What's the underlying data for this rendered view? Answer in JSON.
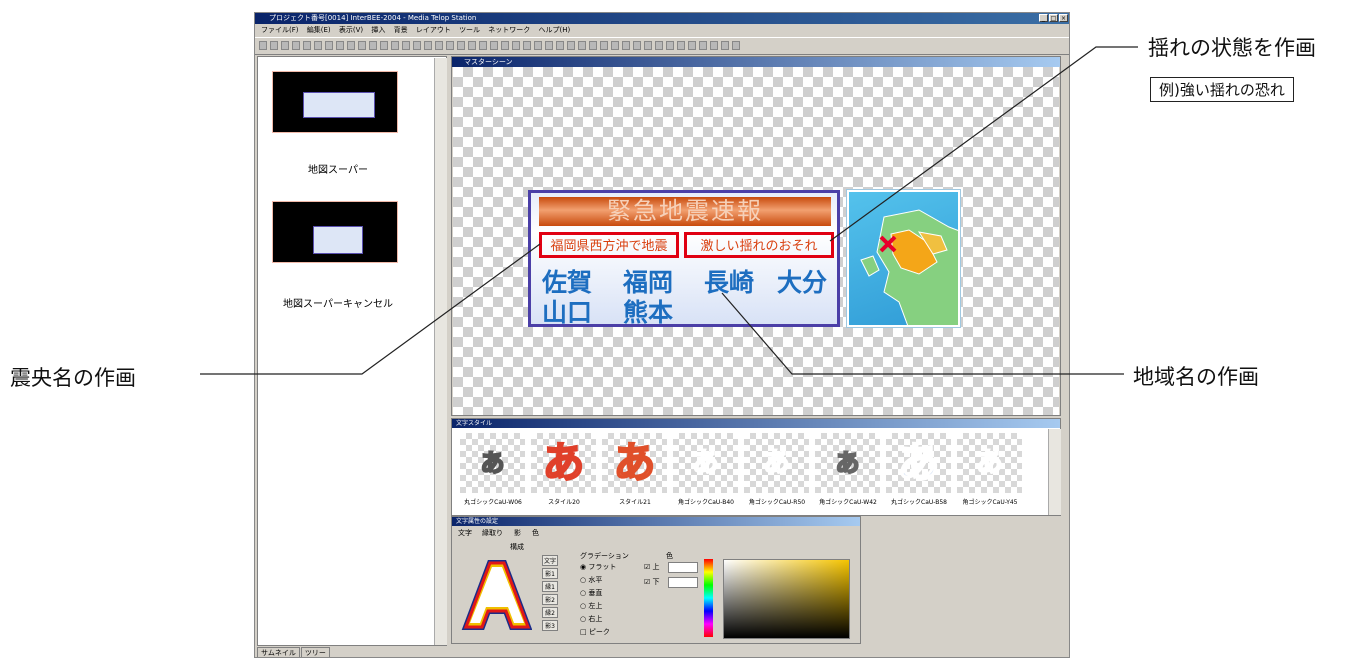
{
  "annotations": {
    "shaking": "揺れの状態を作画",
    "shaking_example": "例)強い揺れの恐れ",
    "epicenter": "震央名の作画",
    "region": "地域名の作画"
  },
  "window": {
    "title": "プロジェクト番号[0014] InterBEE-2004 - Media Telop Station"
  },
  "menu": [
    "ファイル(F)",
    "編集(E)",
    "表示(V)",
    "挿入",
    "背景",
    "レイアウト",
    "ツール",
    "ネットワーク",
    "ヘルプ(H)"
  ],
  "thumbnails": {
    "items": [
      {
        "label": "地図スーパー"
      },
      {
        "label": "地図スーパーキャンセル"
      }
    ],
    "tabs": [
      "サムネイル",
      "ツリー"
    ]
  },
  "scene": {
    "title": "マスターシーン",
    "telop": {
      "title": "緊急地震速報",
      "epicenter": "福岡県西方沖で地震",
      "shaking": "激しい揺れのおそれ",
      "regions_line1": [
        "佐賀",
        "福岡",
        "長崎",
        "大分"
      ],
      "regions_line2": [
        "山口",
        "熊本"
      ]
    }
  },
  "text_styles": {
    "title": "文字スタイル",
    "items": [
      {
        "glyph": "あ",
        "name": "丸ゴシックCaU-W06",
        "fill": "#ffffff",
        "stroke": "#555555",
        "size": 24
      },
      {
        "glyph": "あ",
        "name": "スタイル20",
        "fill": "#f08a8a",
        "stroke": "#e0402a",
        "size": 42
      },
      {
        "glyph": "あ",
        "name": "スタイル21",
        "fill": "#f6a08a",
        "stroke": "#e0502a",
        "size": 42
      },
      {
        "glyph": "あ",
        "name": "角ゴシックCaU-B40",
        "fill": "#1e64c8",
        "stroke": "#ffffff",
        "size": 26
      },
      {
        "glyph": "あ",
        "name": "角ゴシックCaU-R50",
        "fill": "#d03a28",
        "stroke": "#ffffff",
        "size": 26
      },
      {
        "glyph": "あ",
        "name": "角ゴシックCaU-W42",
        "fill": "#ffffff",
        "stroke": "#666666",
        "size": 24
      },
      {
        "glyph": "あ",
        "name": "丸ゴシックCaU-B58",
        "fill": "#1e64c8",
        "stroke": "#ffffff",
        "size": 42
      },
      {
        "glyph": "あ",
        "name": "角ゴシックCaU-Y45",
        "fill": "#f0c070",
        "stroke": "#ffffff",
        "size": 26
      }
    ]
  },
  "text_attributes": {
    "title": "文字属性の設定",
    "tabs": [
      "文字",
      "縁取り",
      "影",
      "色"
    ],
    "composition_label": "構成",
    "layers": [
      "文字",
      "影1",
      "縁1",
      "影2",
      "縁2",
      "影3"
    ],
    "gradation_label": "グラデーション",
    "gradation_options": [
      "フラット",
      "水平",
      "垂直",
      "左上",
      "右上",
      "ピーク"
    ],
    "gradation_selected": "フラット",
    "color_label": "色",
    "color_targets": [
      "上",
      "下"
    ],
    "colors": {
      "accent": "#4b3fa7",
      "highlight": "#e00012"
    }
  }
}
